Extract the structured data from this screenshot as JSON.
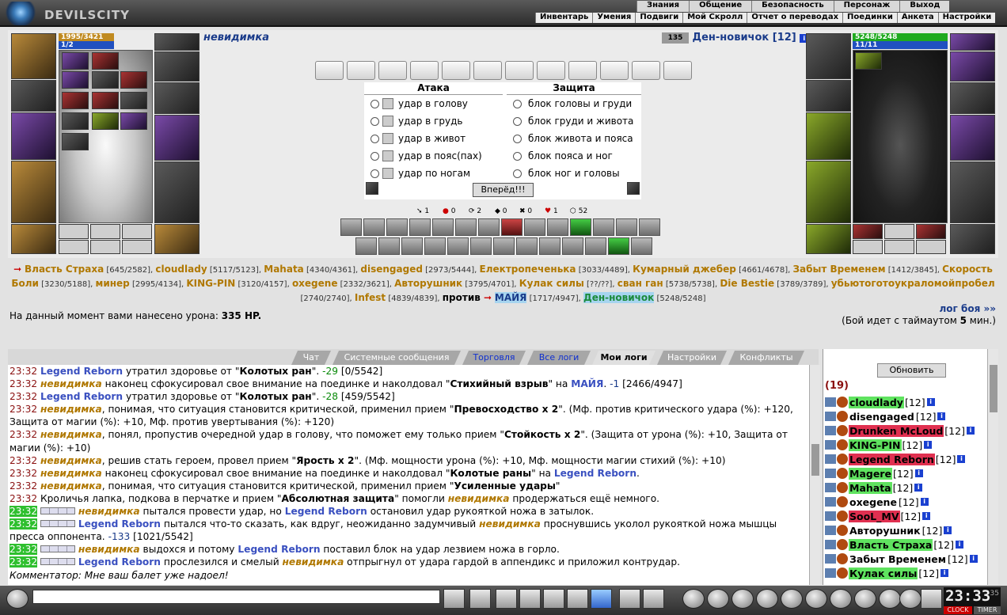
{
  "header": {
    "logo": "DEVILSCITY",
    "top_menu": [
      "Знания",
      "Общение",
      "Безопасность",
      "Персонаж",
      "Выход"
    ],
    "sub_menu": [
      "Инвентарь",
      "Умения",
      "Подвиги",
      "Мой Скролл",
      "Отчет о переводах",
      "Поединки",
      "Анкета",
      "Настройки"
    ]
  },
  "player1": {
    "name": "невидимка",
    "hp": "1995/3421",
    "mana": "1/2"
  },
  "player2": {
    "name": "Ден-новичок",
    "level": "[12]",
    "hp": "5248/5248",
    "mana": "11/11",
    "badge": "135"
  },
  "attack": {
    "title": "Атака",
    "options": [
      "удар в голову",
      "удар в грудь",
      "удар в живот",
      "удар в пояс(пах)",
      "удар по ногам"
    ]
  },
  "defense": {
    "title": "Защита",
    "options": [
      "блок головы и груди",
      "блок груди и живота",
      "блок живота и пояса",
      "блок пояса и ног",
      "блок ног и головы"
    ]
  },
  "go_button": "Вперёд!!!",
  "stats": [
    "1",
    "0",
    "2",
    "0",
    "0",
    "1",
    "52"
  ],
  "team1": [
    {
      "n": "Власть Страха",
      "v": "[645/2582]"
    },
    {
      "n": "cloudlady",
      "v": "[5117/5123]"
    },
    {
      "n": "Mahata",
      "v": "[4340/4361]"
    },
    {
      "n": "disengaged",
      "v": "[2973/5444]"
    },
    {
      "n": "Електропеченька",
      "v": "[3033/4489]"
    },
    {
      "n": "Кумарный джебер",
      "v": "[4661/4678]"
    },
    {
      "n": "Забыт Временем",
      "v": "[1412/3845]"
    },
    {
      "n": "Скорость Боли",
      "v": "[3230/5188]"
    },
    {
      "n": "минер",
      "v": "[2995/4134]"
    },
    {
      "n": "KING-PIN",
      "v": "[3120/4157]"
    },
    {
      "n": "oxegene",
      "v": "[2332/3621]"
    },
    {
      "n": "Авторушник",
      "v": "[3795/4701]"
    },
    {
      "n": "Кулак силы",
      "v": "[??/??]"
    },
    {
      "n": "сван ган",
      "v": "[5738/5738]"
    },
    {
      "n": "Die Bestie",
      "v": "[3789/3789]"
    },
    {
      "n": "убьютоготоукраломойпробел",
      "v": "[2740/2740]"
    },
    {
      "n": "Infest",
      "v": "[4839/4839]"
    }
  ],
  "versus": "против",
  "team2": [
    {
      "n": "МАЙЯ",
      "v": "[1717/4947]"
    },
    {
      "n": "Ден-новичок",
      "v": "[5248/5248]"
    }
  ],
  "damage_text": "На данный момент вами нанесено урона:",
  "damage_value": "335 HP.",
  "battle_log_link": "лог боя »»",
  "timeout_text": "(Бой идет с таймаутом",
  "timeout_value": "5",
  "timeout_unit": "мин.)",
  "tabs": [
    "Чат",
    "Системные сообщения",
    "Торговля",
    "Все логи",
    "Мои логи",
    "Настройки",
    "Конфликты"
  ],
  "chat": [
    {
      "time": "23:32",
      "parts": [
        [
          "lr",
          "Legend Reborn"
        ],
        [
          "",
          "утратил здоровье от \""
        ],
        [
          "b",
          "Колотых ран"
        ],
        [
          "",
          "\". "
        ],
        [
          "grn",
          "-29"
        ],
        [
          "",
          " [0/5542]"
        ]
      ]
    },
    {
      "time": "23:32",
      "parts": [
        [
          "nv",
          "невидимка"
        ],
        [
          "",
          " наконец сфокусировал свое внимание на поединке и наколдовал \""
        ],
        [
          "b",
          "Стихийный взрыв"
        ],
        [
          "",
          "\" на "
        ],
        [
          "lr",
          "МАЙЯ"
        ],
        [
          "",
          ". "
        ],
        [
          "blu",
          "-1"
        ],
        [
          "",
          " [2466/4947]"
        ]
      ]
    },
    {
      "time": "23:32",
      "parts": [
        [
          "lr",
          "Legend Reborn"
        ],
        [
          "",
          "утратил здоровье от \""
        ],
        [
          "b",
          "Колотых ран"
        ],
        [
          "",
          "\". "
        ],
        [
          "grn",
          "-28"
        ],
        [
          "",
          " [459/5542]"
        ]
      ]
    },
    {
      "time": "23:32",
      "parts": [
        [
          "nv",
          "невидимка"
        ],
        [
          "",
          ", понимая, что ситуация становится критической, применил прием \""
        ],
        [
          "b",
          "Превосходство x 2"
        ],
        [
          "",
          "\". (Мф. против критического удара (%): +120, Защита от магии (%): +10, Мф. против увертывания (%): +120)"
        ]
      ]
    },
    {
      "time": "23:32",
      "parts": [
        [
          "nv",
          "невидимка"
        ],
        [
          "",
          ", понял, пропустив очередной удар в голову, что поможет ему только прием \""
        ],
        [
          "b",
          "Стойкость x 2"
        ],
        [
          "",
          "\". (Защита от урона (%): +10, Защита от магии (%): +10)"
        ]
      ]
    },
    {
      "time": "23:32",
      "parts": [
        [
          "nv",
          "невидимка"
        ],
        [
          "",
          ", решив стать героем, провел прием \""
        ],
        [
          "b",
          "Ярость x 2"
        ],
        [
          "",
          "\". (Мф. мощности урона (%): +10, Мф. мощности магии стихий (%): +10)"
        ]
      ]
    },
    {
      "time": "23:32",
      "parts": [
        [
          "nv",
          "невидимка"
        ],
        [
          "",
          " наконец сфокусировал свое внимание на поединке и наколдовал \""
        ],
        [
          "b",
          "Колотые раны"
        ],
        [
          "",
          "\" на "
        ],
        [
          "lr",
          "Legend Reborn"
        ],
        [
          "",
          "."
        ]
      ]
    },
    {
      "time": "23:32",
      "parts": [
        [
          "nv",
          "невидимка"
        ],
        [
          "",
          ", понимая, что ситуация становится критической, применил прием \""
        ],
        [
          "b",
          "Усиленные удары"
        ],
        [
          "",
          "\""
        ]
      ]
    },
    {
      "time": "23:32",
      "parts": [
        [
          "",
          "Кроличья лапка, подкова в перчатке и прием \""
        ],
        [
          "b",
          "Абсолютная защита"
        ],
        [
          "",
          "\" помогли "
        ],
        [
          "nv",
          "невидимка"
        ],
        [
          "",
          " продержаться ещё немного."
        ]
      ]
    },
    {
      "time": "23:32",
      "hl": true,
      "sq": true,
      "parts": [
        [
          "nv",
          "невидимка"
        ],
        [
          "",
          " пытался провести удар, но "
        ],
        [
          "lr",
          "Legend Reborn"
        ],
        [
          "",
          " остановил удар рукояткой ножа в затылок."
        ]
      ]
    },
    {
      "time": "23:32",
      "hl": true,
      "sq": true,
      "parts": [
        [
          "lr",
          "Legend Reborn"
        ],
        [
          "",
          " пытался что-то сказать, как вдруг, неожиданно задумчивый "
        ],
        [
          "nv",
          "невидимка"
        ],
        [
          "",
          " проснувшись уколол рукояткой ножа мышцы пресса оппонента. "
        ],
        [
          "blu",
          "-133"
        ],
        [
          "",
          " [1021/5542]"
        ]
      ]
    },
    {
      "time": "23:32",
      "hl": true,
      "sq": true,
      "parts": [
        [
          "nv",
          "невидимка"
        ],
        [
          "",
          " выдохся и потому "
        ],
        [
          "lr",
          "Legend Reborn"
        ],
        [
          "",
          " поставил блок на удар лезвием ножа в горло."
        ]
      ]
    },
    {
      "time": "23:32",
      "hl": true,
      "sq": true,
      "parts": [
        [
          "lr",
          "Legend Reborn"
        ],
        [
          "",
          " прослезился и смелый "
        ],
        [
          "nv",
          "невидимка"
        ],
        [
          "",
          " отпрыгнул от удара гардой в аппендикс и приложил контрудар."
        ]
      ]
    },
    {
      "time": "",
      "parts": [
        [
          "i",
          "Комментатор: Мне ваш балет уже надоел!"
        ]
      ]
    }
  ],
  "right_panel": {
    "refresh": "Обновить",
    "count": "(19)",
    "players": [
      {
        "n": "cloudlady",
        "l": "[12]",
        "bg": "#5fe35f",
        "c": "#000"
      },
      {
        "n": "disengaged",
        "l": "[12]",
        "bg": "",
        "c": "#000"
      },
      {
        "n": "Drunken McLoud",
        "l": "[12]",
        "bg": "#e03050",
        "c": "#000"
      },
      {
        "n": "KING-PIN",
        "l": "[12]",
        "bg": "#5fe35f",
        "c": "#000"
      },
      {
        "n": "Legend Reborn",
        "l": "[12]",
        "bg": "#e03050",
        "c": "#000"
      },
      {
        "n": "Magere",
        "l": "[12]",
        "bg": "#5fe35f",
        "c": "#000"
      },
      {
        "n": "Mahata",
        "l": "[12]",
        "bg": "#5fe35f",
        "c": "#000"
      },
      {
        "n": "oxegene",
        "l": "[12]",
        "bg": "",
        "c": "#000"
      },
      {
        "n": "SooL_MV",
        "l": "[12]",
        "bg": "#e03050",
        "c": "#000"
      },
      {
        "n": "Авторушник",
        "l": "[12]",
        "bg": "",
        "c": "#000"
      },
      {
        "n": "Власть Страха",
        "l": "[12]",
        "bg": "#5fe35f",
        "c": "#000"
      },
      {
        "n": "Забыт Временем",
        "l": "[12]",
        "bg": "",
        "c": "#000"
      },
      {
        "n": "Кулак силы",
        "l": "[12]",
        "bg": "#5fe35f",
        "c": "#000"
      }
    ]
  },
  "clock": {
    "time": "23:33",
    "sec": "35",
    "l1": "CLOCK",
    "l2": "TIMER"
  },
  "colors": {
    "gold": "#b07800",
    "link": "#1a3b8a",
    "legend": "#3a50c0",
    "green_hl": "#5fe35f",
    "red_hl": "#e03050"
  }
}
